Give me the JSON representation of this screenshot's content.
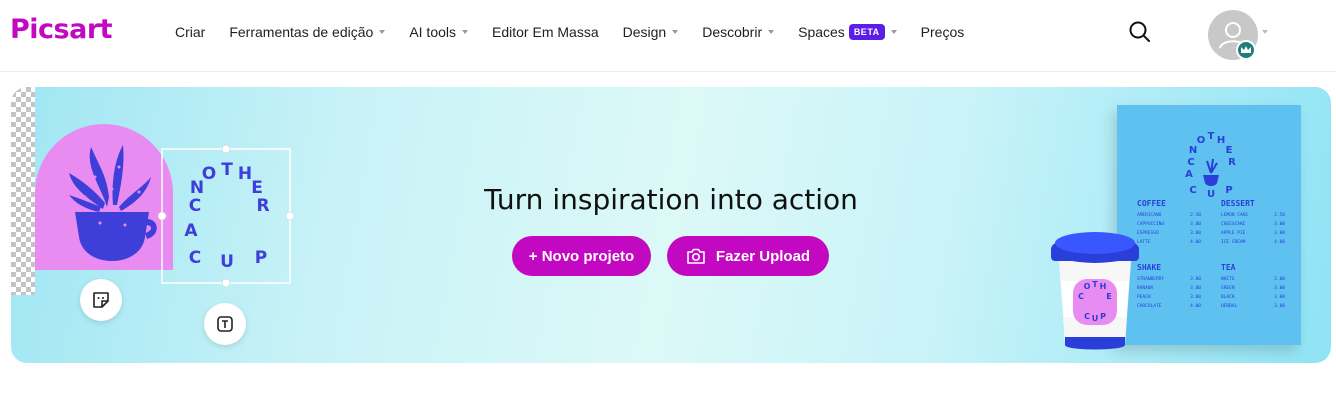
{
  "brand": {
    "logo_text": "Picsart",
    "color": "#c209c1"
  },
  "nav": {
    "items": [
      {
        "label": "Criar",
        "has_dropdown": false
      },
      {
        "label": "Ferramentas de edição",
        "has_dropdown": true
      },
      {
        "label": "AI tools",
        "has_dropdown": true
      },
      {
        "label": "Editor Em Massa",
        "has_dropdown": false
      },
      {
        "label": "Design",
        "has_dropdown": true
      },
      {
        "label": "Descobrir",
        "has_dropdown": true
      },
      {
        "label": "Spaces",
        "has_dropdown": true,
        "badge": "BETA"
      },
      {
        "label": "Preços",
        "has_dropdown": false
      }
    ]
  },
  "header_right": {
    "search_icon": "search-icon",
    "avatar_icon": "user-avatar-icon",
    "crown_icon": "crown-icon"
  },
  "banner": {
    "headline": "Turn inspiration into action",
    "new_project_label": "+ Novo projeto",
    "upload_label": "Fazer Upload",
    "accent": "#c209c1",
    "artwork": {
      "circular_text": "CANOTHERCUP",
      "menu": {
        "sections": [
          {
            "title": "COFFEE",
            "items": [
              [
                "AMERICANO",
                "2.50"
              ],
              [
                "CAPPUCCINO",
                "3.00"
              ],
              [
                "ESPRESSO",
                "3.00"
              ],
              [
                "LATTE",
                "4.00"
              ]
            ]
          },
          {
            "title": "DESSERT",
            "items": [
              [
                "LEMON CAKE",
                "2.50"
              ],
              [
                "CHEESCAKE",
                "3.00"
              ],
              [
                "APPLE PIE",
                "3.00"
              ],
              [
                "ICE CREAM",
                "4.00"
              ]
            ]
          },
          {
            "title": "SHAKE",
            "items": [
              [
                "STRAWBERRY",
                "3.00"
              ],
              [
                "BANANA",
                "3.00"
              ],
              [
                "PEACH",
                "3.00"
              ],
              [
                "CHOCOLATE",
                "4.00"
              ]
            ]
          },
          {
            "title": "TEA",
            "items": [
              [
                "WHITE",
                "3.00"
              ],
              [
                "GREEN",
                "3.00"
              ],
              [
                "BLACK",
                "3.00"
              ],
              [
                "HERBAL",
                "3.00"
              ]
            ]
          }
        ]
      }
    }
  }
}
